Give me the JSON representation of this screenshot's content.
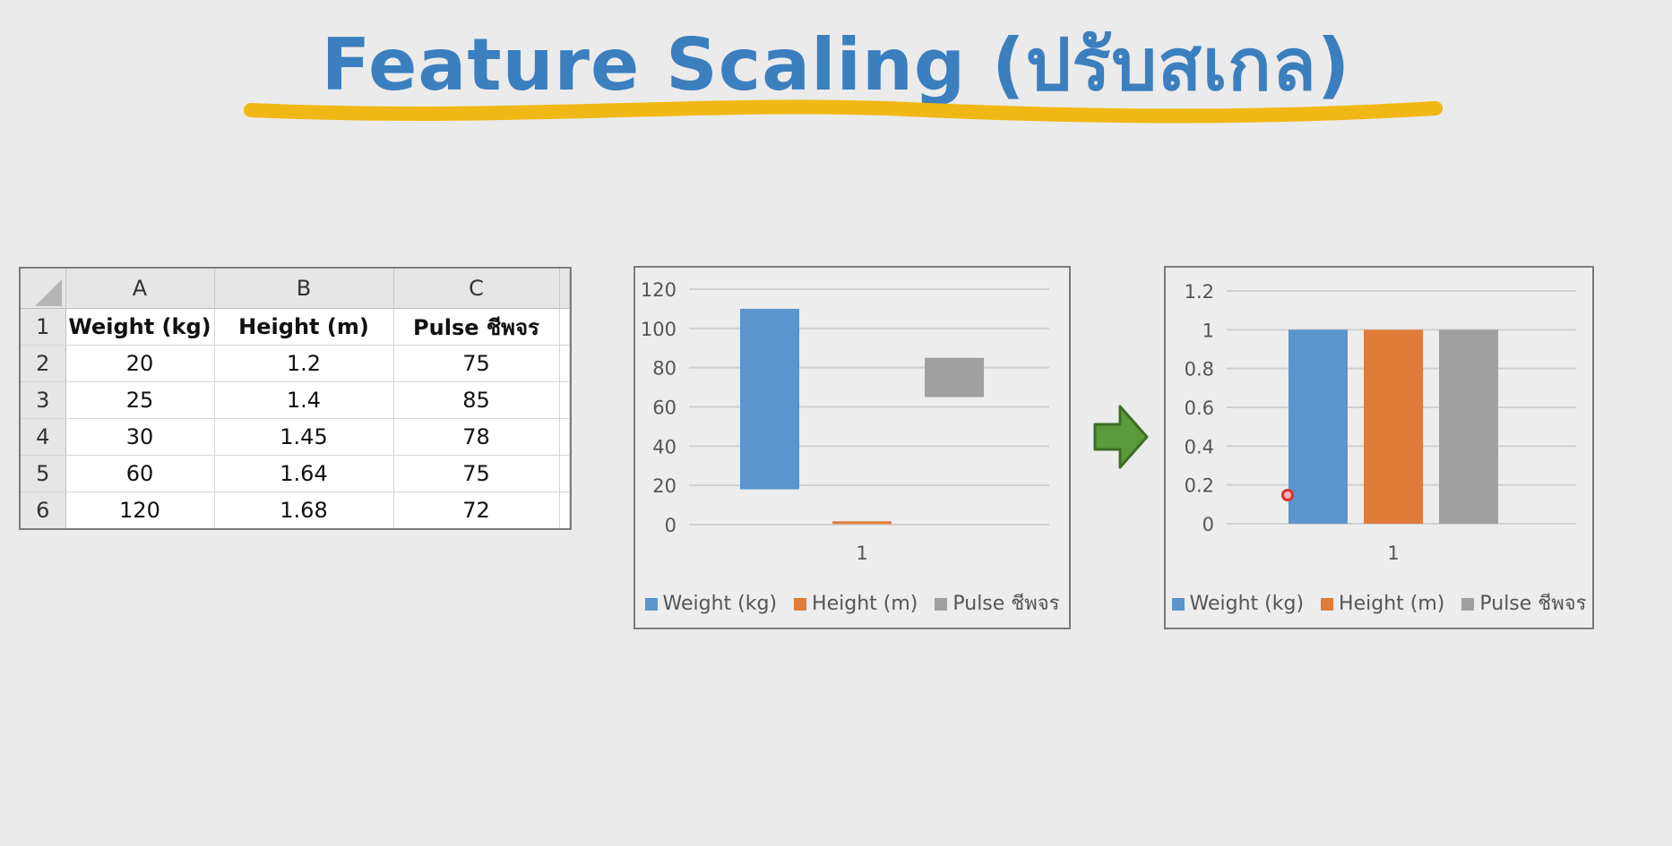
{
  "title": "Feature Scaling (ปรับสเกล)",
  "colors": {
    "title": "#3b7fbf",
    "underline": "#f0b814",
    "weight": "#5b95cc",
    "height": "#e07b39",
    "pulse": "#a0a0a0",
    "arrow": "#5a9a3c"
  },
  "sheet": {
    "columns": [
      "A",
      "B",
      "C"
    ],
    "row_numbers": [
      "1",
      "2",
      "3",
      "4",
      "5",
      "6"
    ],
    "header": [
      "Weight (kg)",
      "Height (m)",
      "Pulse ชีพจร"
    ],
    "rows": [
      [
        "20",
        "1.2",
        "75"
      ],
      [
        "25",
        "1.4",
        "85"
      ],
      [
        "30",
        "1.45",
        "78"
      ],
      [
        "60",
        "1.64",
        "75"
      ],
      [
        "120",
        "1.68",
        "72"
      ]
    ]
  },
  "chart_data": [
    {
      "type": "bar",
      "title": "",
      "categories": [
        "1"
      ],
      "ylim": [
        0,
        120
      ],
      "yticks": [
        0,
        20,
        40,
        60,
        80,
        100,
        120
      ],
      "ytick_labels": [
        "0",
        "20",
        "40",
        "60",
        "80",
        "100",
        "120"
      ],
      "grid": true,
      "legend": "bottom",
      "series": [
        {
          "name": "Weight (kg)",
          "low": 18,
          "high": 110
        },
        {
          "name": "Height (m)",
          "low": 1.2,
          "high": 1.68
        },
        {
          "name": "Pulse ชีพจร",
          "low": 65,
          "high": 85
        }
      ]
    },
    {
      "type": "bar",
      "title": "",
      "categories": [
        "1"
      ],
      "ylim": [
        0,
        1.2
      ],
      "yticks": [
        0,
        0.2,
        0.4,
        0.6,
        0.8,
        1,
        1.2
      ],
      "ytick_labels": [
        "0",
        "0.2",
        "0.4",
        "0.6",
        "0.8",
        "1",
        "1.2"
      ],
      "grid": true,
      "legend": "bottom",
      "series": [
        {
          "name": "Weight (kg)",
          "low": 0,
          "high": 1
        },
        {
          "name": "Height (m)",
          "low": 0,
          "high": 1
        },
        {
          "name": "Pulse ชีพจร",
          "low": 0,
          "high": 1
        }
      ]
    }
  ]
}
